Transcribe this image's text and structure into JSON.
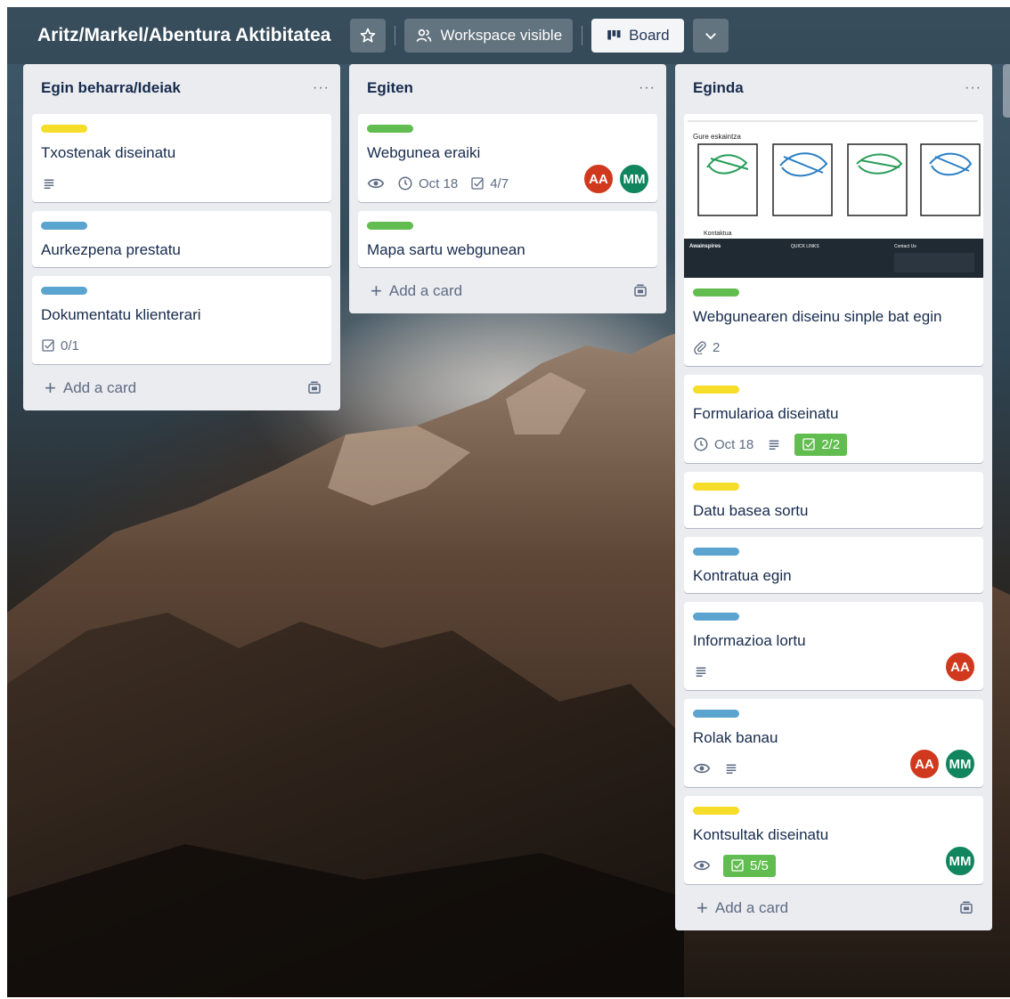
{
  "board": {
    "title": "Aritz/Markel/Abentura Aktibitatea",
    "visibility_label": "Workspace visible",
    "view_label": "Board",
    "icons": [
      "star-icon",
      "people-icon",
      "board-icon",
      "chevron-down-icon"
    ]
  },
  "lists": [
    {
      "title": "Egin beharra/Ideiak",
      "menu": "···",
      "add_card": "Add a card",
      "cards": [
        {
          "label_color": "#f5dd29",
          "title": "Txostenak diseinatu",
          "description_icon": "description-icon"
        },
        {
          "label_color": "#5ba4cf",
          "title": "Aurkezpena prestatu"
        },
        {
          "label_color": "#5ba4cf",
          "title": "Dokumentatu klienterari",
          "checklist": "0/1"
        }
      ]
    },
    {
      "title": "Egiten",
      "menu": "···",
      "add_card": "Add a card",
      "cards": [
        {
          "label_color": "#61bd4f",
          "title": "Webgunea eraiki",
          "due": "Oct 18",
          "checklist": "4/7",
          "members": [
            "AA",
            "MM"
          ]
        },
        {
          "label_color": "#61bd4f",
          "title": "Mapa sartu webgunean"
        }
      ]
    },
    {
      "title": "Eginda",
      "menu": "···",
      "add_card": "Add a card",
      "cards": [
        {
          "label_color": "#61bd4f",
          "title": "Webgunearen diseinu sinple bat egin",
          "attachments": "2",
          "cover": {
            "heading": "Gure eskaintza",
            "contact_heading": "Kontaktua",
            "footer_brand": "Awainspires",
            "footer_links_heading": "QUICK LINKS",
            "footer_contact_heading": "Contact Us"
          }
        },
        {
          "label_color": "#f5dd29",
          "title": "Formularioa diseinatu",
          "due": "Oct 18",
          "checklist": "2/2"
        },
        {
          "label_color": "#f5dd29",
          "title": "Datu basea sortu"
        },
        {
          "label_color": "#5ba4cf",
          "title": "Kontratua egin"
        },
        {
          "label_color": "#5ba4cf",
          "title": "Informazioa lortu",
          "members": [
            "AA"
          ]
        },
        {
          "label_color": "#5ba4cf",
          "title": "Rolak banau",
          "members": [
            "AA",
            "MM"
          ]
        },
        {
          "label_color": "#f5dd29",
          "title": "Kontsultak diseinatu",
          "checklist": "5/5",
          "members": [
            "MM"
          ]
        }
      ]
    }
  ]
}
